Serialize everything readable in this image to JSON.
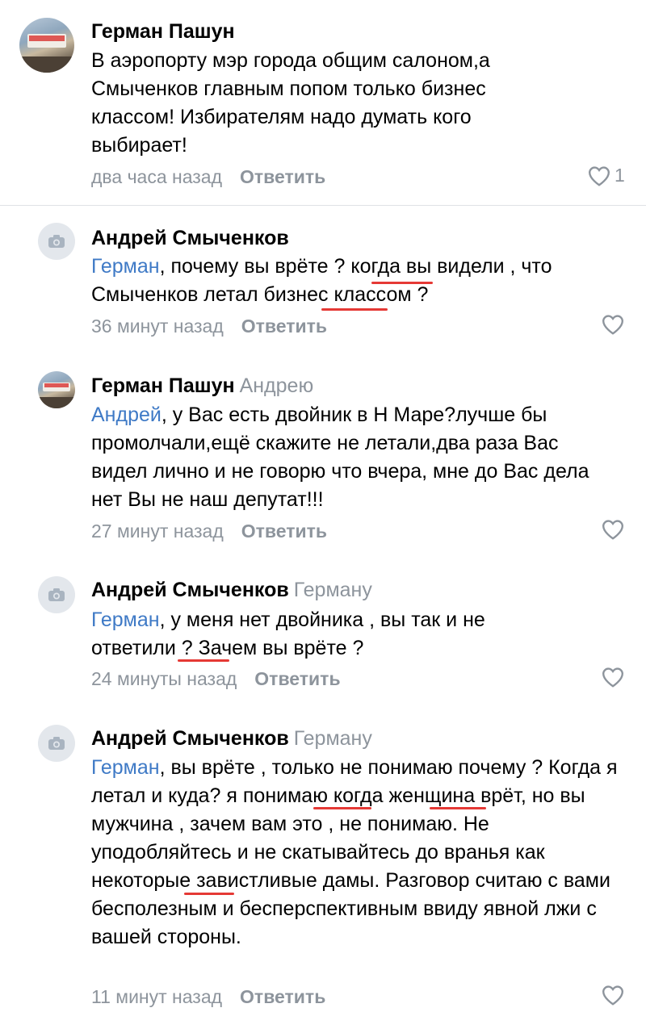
{
  "comments": [
    {
      "author": "Герман Пашун",
      "reply_to": "",
      "mention": "",
      "text": "В аэропорту мэр города общим салоном,а Смыченков главным попом только бизнес классом! Избирателям надо думать кого выбирает!",
      "time": "два часа назад",
      "reply_label": "Ответить",
      "likes": "1",
      "avatar_icon": "user-photo-avatar"
    },
    {
      "author": "Андрей Смыченков",
      "reply_to": "",
      "mention": "Герман",
      "text": ", почему вы врёте ? когда вы видели , что Смыченков летал бизнес классом ?",
      "time": "36 минут назад",
      "reply_label": "Ответить",
      "likes": "",
      "avatar_icon": "camera-icon"
    },
    {
      "author": "Герман Пашун",
      "reply_to": "Андрею",
      "mention": "Андрей",
      "text": ", у Вас есть двойник в Н Маре?лучше бы промолчали,ещё скажите не летали,два раза Вас видел лично и не говорю что вчера, мне до Вас дела нет Вы не наш депутат!!!",
      "time": "27 минут назад",
      "reply_label": "Ответить",
      "likes": "",
      "avatar_icon": "user-photo-avatar"
    },
    {
      "author": "Андрей Смыченков",
      "reply_to": "Герману",
      "mention": "Герман",
      "text": ", у меня нет двойника , вы так и не ответили ? Зачем вы врёте ?",
      "time": "24 минуты назад",
      "reply_label": "Ответить",
      "likes": "",
      "avatar_icon": "camera-icon"
    },
    {
      "author": "Андрей Смыченков",
      "reply_to": "Герману",
      "mention": "Герман",
      "text": ", вы врёте , только не понимаю почему ? Когда я летал и куда?  я понимаю когда женщина врёт, но вы мужчина , зачем вам это , не понимаю. Не уподобляйтесь и не скатывайтесь до вранья как некоторые завистливые  дамы. Разговор считаю с вами бесполезным и бесперспективным ввиду явной лжи с вашей стороны.",
      "time": "11 минут назад",
      "reply_label": "Ответить",
      "likes": "",
      "avatar_icon": "camera-icon"
    }
  ],
  "colors": {
    "mention": "#3f7ac6",
    "meta": "#8d949c",
    "divider": "#dfe2e6",
    "underline": "#e53935"
  }
}
